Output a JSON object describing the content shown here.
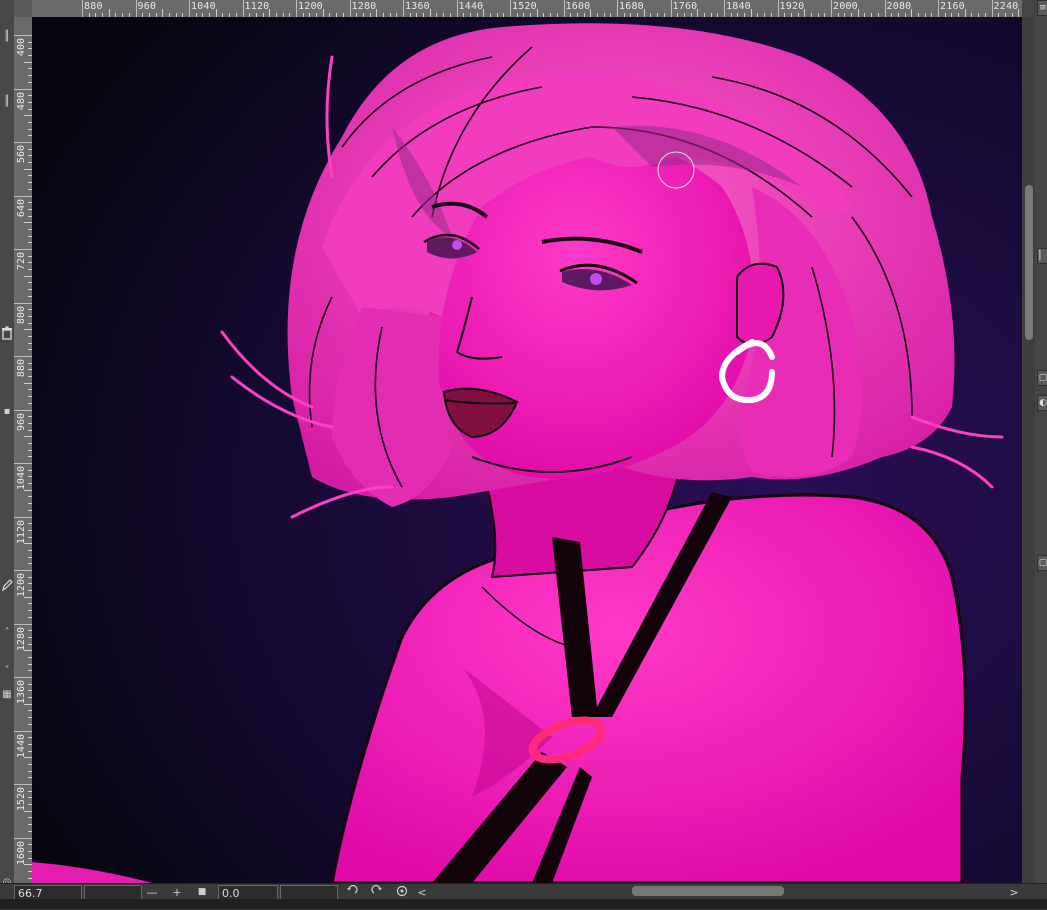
{
  "app": {
    "icons": {
      "trash": "trash-icon",
      "pen": "pen-icon",
      "rotate_left": "rotate-left-icon",
      "rotate_right": "rotate-right-icon",
      "reset_rotation": "reset-rotation-icon"
    }
  },
  "ruler": {
    "horizontal": [
      "880",
      "960",
      "1040",
      "1120",
      "1200",
      "1280",
      "1360",
      "1440",
      "1520",
      "1600",
      "1680",
      "1760",
      "1840",
      "1920",
      "2000",
      "2080",
      "2160",
      "2240"
    ],
    "vertical": [
      "400",
      "480",
      "560",
      "640",
      "720",
      "800",
      "880",
      "960",
      "1040",
      "1120",
      "1200",
      "1280",
      "1360",
      "1440",
      "1520",
      "1600"
    ]
  },
  "statusbar": {
    "zoom_value": "66.7",
    "zoom_out": "—",
    "zoom_in": "+",
    "fit": "■",
    "rotation_value": "0.0",
    "scroll_left": "<",
    "scroll_right": ">"
  },
  "colors": {
    "background_dark": "#0d0820",
    "skin_magenta": "#f012b8",
    "hair_pink": "#f22fb9",
    "lineart": "#1a0612",
    "earring": "#ffffff"
  }
}
